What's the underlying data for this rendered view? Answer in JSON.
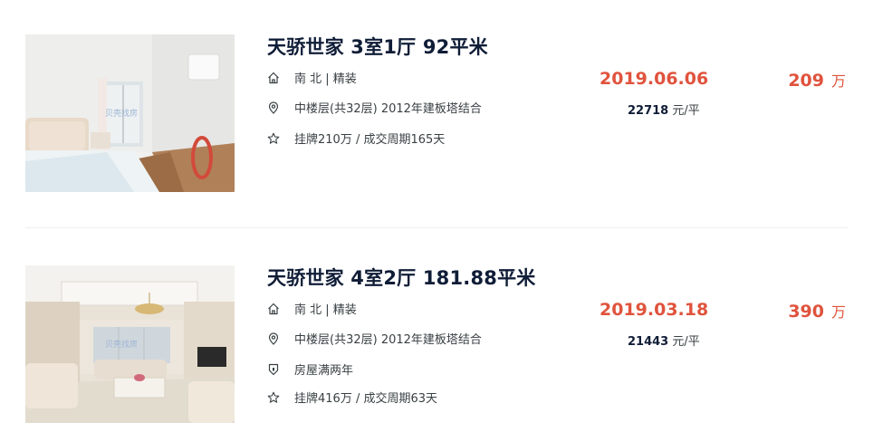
{
  "listings": [
    {
      "title": "天骄世家 3室1厅 92平米",
      "orientation_decor": "南 北 | 精装",
      "floor_info": "中楼层(共32层) 2012年建板塔结合",
      "listing_info": "挂牌210万 / 成交周期165天",
      "deal_date": "2019.06.06",
      "unit_price_value": "22718",
      "unit_price_unit": "元/平",
      "total_price": "209",
      "total_price_unit": "万",
      "image_watermark": "贝壳找房"
    },
    {
      "title": "天骄世家 4室2厅 181.88平米",
      "orientation_decor": "南 北 | 精装",
      "floor_info": "中楼层(共32层) 2012年建板塔结合",
      "tag": "房屋满两年",
      "listing_info": "挂牌416万 / 成交周期63天",
      "deal_date": "2019.03.18",
      "unit_price_value": "21443",
      "unit_price_unit": "元/平",
      "total_price": "390",
      "total_price_unit": "万",
      "image_watermark": "贝壳找房"
    }
  ],
  "icons": {
    "house": "house-icon",
    "location": "location-pin-icon",
    "star": "star-icon",
    "shield": "shield-icon"
  },
  "colors": {
    "price_red": "#e0533d",
    "title_dark": "#101d37"
  }
}
